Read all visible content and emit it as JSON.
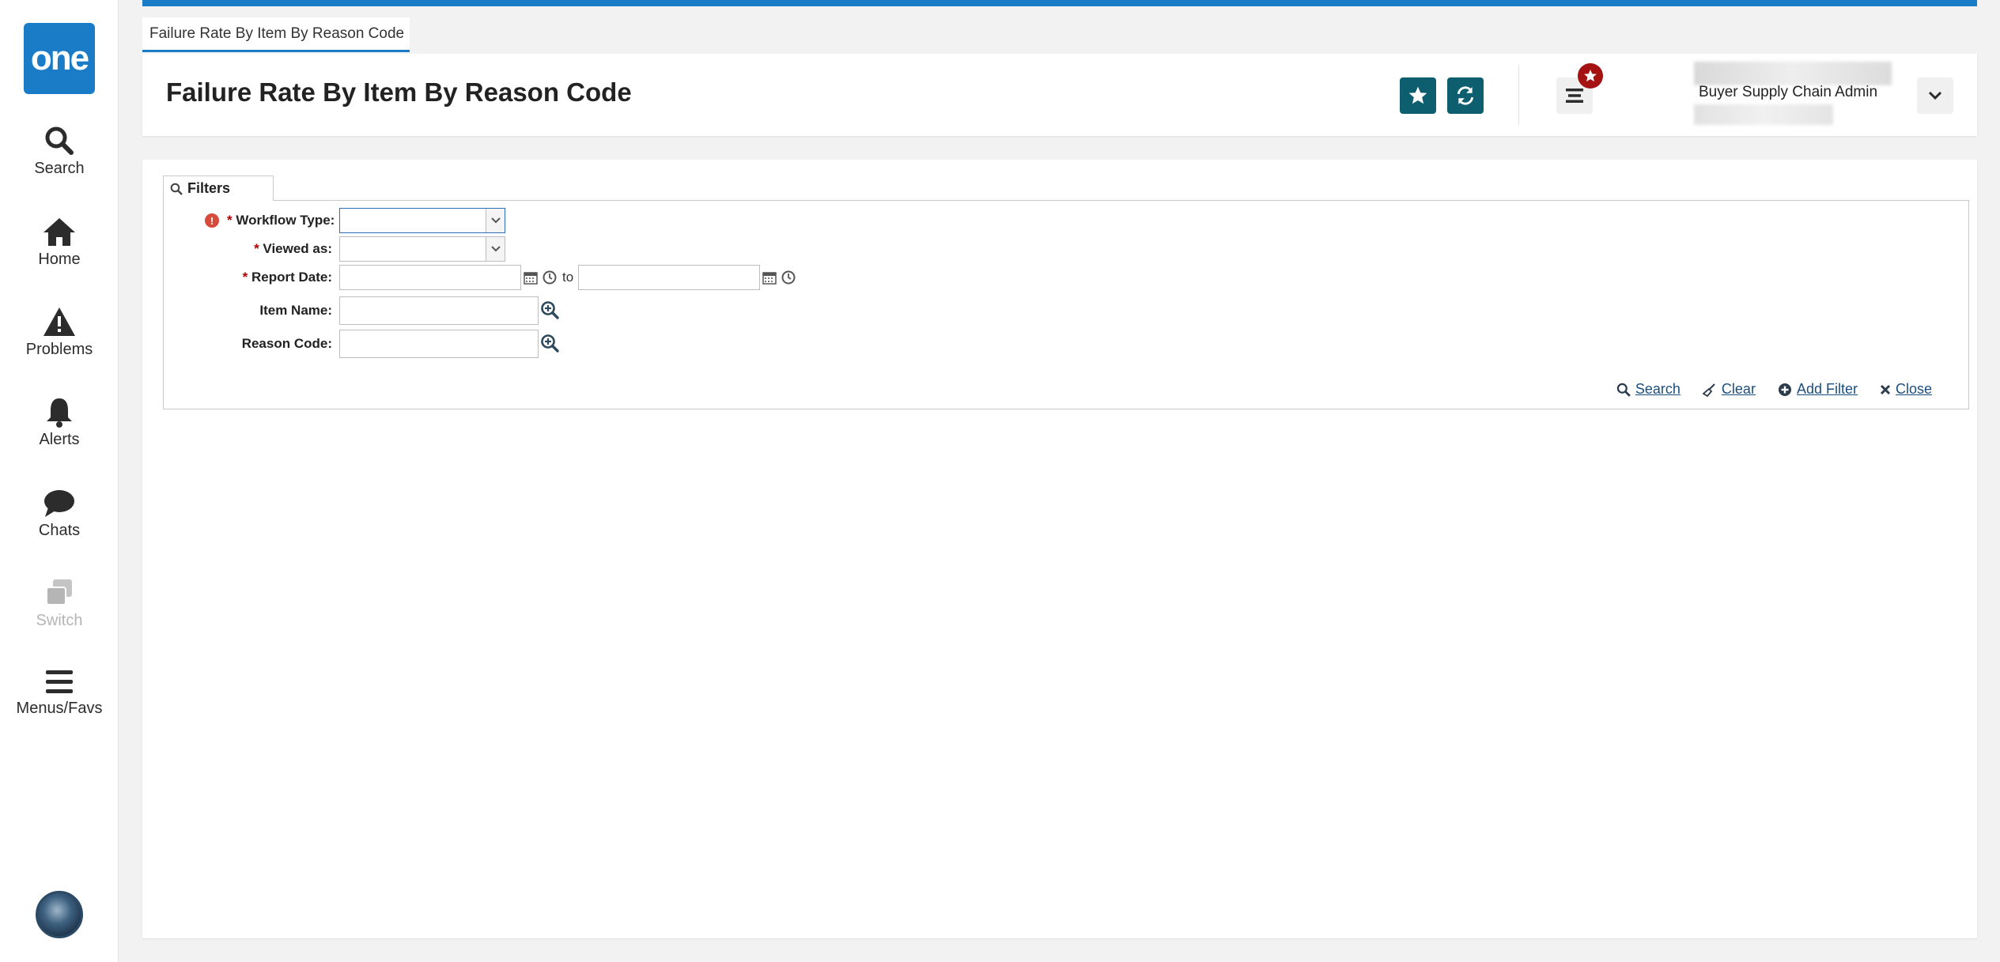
{
  "colors": {
    "brand_blue": "#1a7cc7",
    "teal_button": "#0d5e6e",
    "badge_red": "#a41212",
    "link_blue": "#1b4e7e",
    "required_red": "#b30000"
  },
  "sidebar": {
    "logo": "one",
    "items": [
      {
        "label": "Search",
        "icon": "search-icon"
      },
      {
        "label": "Home",
        "icon": "home-icon"
      },
      {
        "label": "Problems",
        "icon": "warning-icon"
      },
      {
        "label": "Alerts",
        "icon": "bell-icon"
      },
      {
        "label": "Chats",
        "icon": "chat-bubble-icon"
      },
      {
        "label": "Switch",
        "icon": "switch-windows-icon"
      },
      {
        "label": "Menus/Favs",
        "icon": "hamburger-menu-icon"
      }
    ]
  },
  "tab": {
    "label": "Failure Rate By Item By Reason Code"
  },
  "header": {
    "title": "Failure Rate By Item By Reason Code",
    "role": "Buyer Supply Chain Admin"
  },
  "filters": {
    "tab_label": "Filters",
    "required_mark": "*",
    "fields": {
      "workflow_type": {
        "label": "Workflow Type:",
        "value": ""
      },
      "viewed_as": {
        "label": "Viewed as:",
        "value": ""
      },
      "report_date": {
        "label": "Report Date:",
        "from": "",
        "to": "",
        "separator": "to"
      },
      "item_name": {
        "label": "Item Name:",
        "value": ""
      },
      "reason_code": {
        "label": "Reason Code:",
        "value": ""
      }
    },
    "actions": {
      "search": "Search",
      "clear": "Clear",
      "add_filter": "Add Filter",
      "close": "Close"
    }
  }
}
